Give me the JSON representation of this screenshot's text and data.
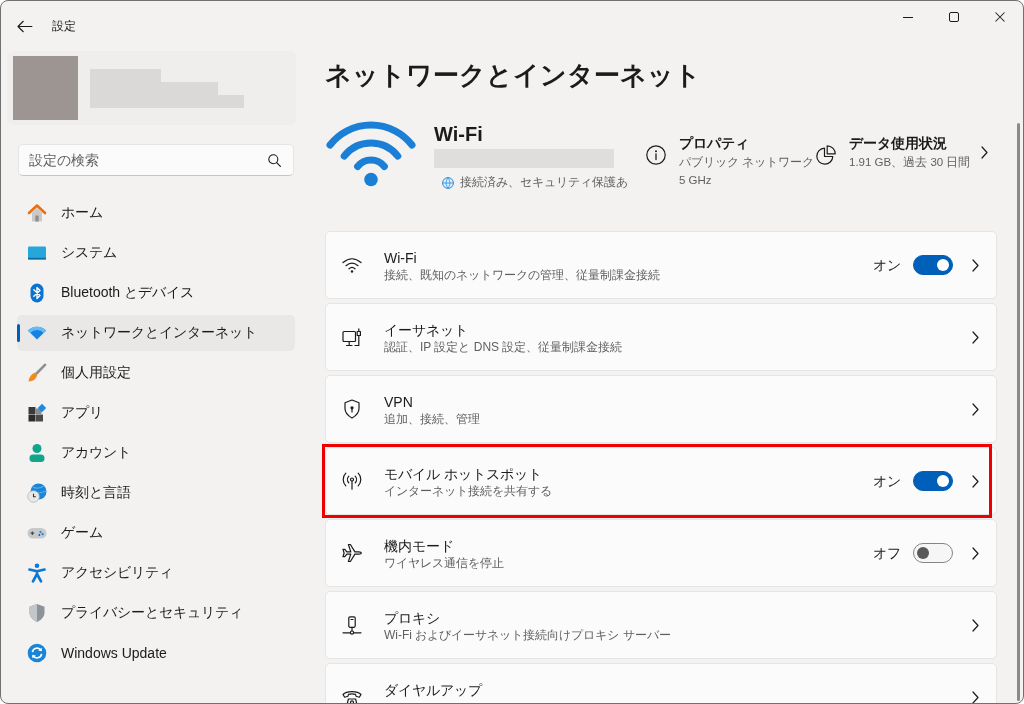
{
  "window": {
    "title": "設定"
  },
  "sidebar": {
    "search": {
      "placeholder": "設定の検索"
    },
    "items": [
      {
        "label": "ホーム",
        "selected": false
      },
      {
        "label": "システム",
        "selected": false
      },
      {
        "label": "Bluetooth とデバイス",
        "selected": false
      },
      {
        "label": "ネットワークとインターネット",
        "selected": true
      },
      {
        "label": "個人用設定",
        "selected": false
      },
      {
        "label": "アプリ",
        "selected": false
      },
      {
        "label": "アカウント",
        "selected": false
      },
      {
        "label": "時刻と言語",
        "selected": false
      },
      {
        "label": "ゲーム",
        "selected": false
      },
      {
        "label": "アクセシビリティ",
        "selected": false
      },
      {
        "label": "プライバシーとセキュリティ",
        "selected": false
      },
      {
        "label": "Windows Update",
        "selected": false
      }
    ]
  },
  "page": {
    "title": "ネットワークとインターネット"
  },
  "connection": {
    "name": "Wi-Fi",
    "status": "接続済み、セキュリティ保護あ",
    "properties": {
      "title": "プロパティ",
      "lines": [
        "パブリック ネットワーク",
        "5 GHz"
      ]
    },
    "data_usage": {
      "title": "データ使用状況",
      "detail": "1.91 GB、過去 30 日間"
    }
  },
  "settings": [
    {
      "kind": "toggle",
      "title": "Wi-Fi",
      "subtitle": "接続、既知のネットワークの管理、従量制課金接続",
      "state_label": "オン",
      "on": true,
      "highlighted": false
    },
    {
      "kind": "link",
      "title": "イーサネット",
      "subtitle": "認証、IP 設定と DNS 設定、従量制課金接続",
      "highlighted": false
    },
    {
      "kind": "link",
      "title": "VPN",
      "subtitle": "追加、接続、管理",
      "highlighted": false
    },
    {
      "kind": "toggle",
      "title": "モバイル ホットスポット",
      "subtitle": "インターネット接続を共有する",
      "state_label": "オン",
      "on": true,
      "highlighted": true
    },
    {
      "kind": "toggle",
      "title": "機内モード",
      "subtitle": "ワイヤレス通信を停止",
      "state_label": "オフ",
      "on": false,
      "highlighted": false
    },
    {
      "kind": "link",
      "title": "プロキシ",
      "subtitle": "Wi-Fi およびイーサネット接続向けプロキシ サーバー",
      "highlighted": false
    },
    {
      "kind": "link",
      "title": "ダイヤルアップ",
      "highlighted": false
    }
  ]
}
